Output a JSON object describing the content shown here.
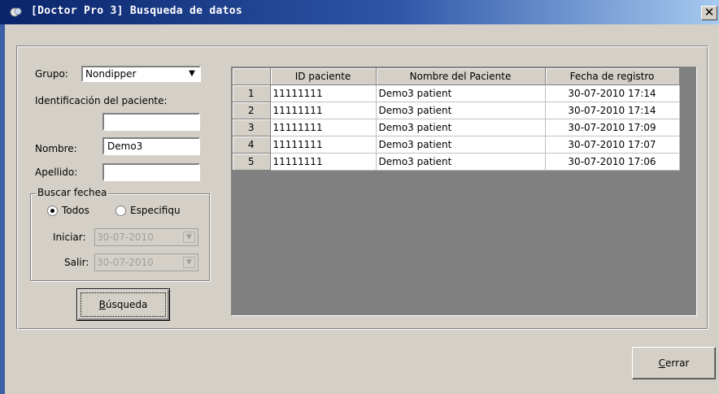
{
  "window": {
    "title": "[Doctor Pro 3] Busqueda de datos",
    "close_symbol": "✕"
  },
  "form": {
    "grupo_label": "Grupo:",
    "grupo_value": "Nondipper",
    "id_label": "Identificación del paciente:",
    "id_value": "",
    "nombre_label": "Nombre:",
    "nombre_value": "Demo3",
    "apellido_label": "Apellido:",
    "apellido_value": "",
    "buscar_fecha": {
      "title": "Buscar fechea",
      "option_all": "Todos",
      "option_specific": "Especifiqu",
      "selected": "Todos",
      "iniciar_label": "Iniciar:",
      "iniciar_value": "30-07-2010",
      "salir_label": "Salir:",
      "salir_value": "30-07-2010"
    },
    "search_button": {
      "mnemonic": "B",
      "rest": "úsqueda"
    }
  },
  "table": {
    "headers": [
      "",
      "ID paciente",
      "Nombre del Paciente",
      "Fecha de registro"
    ],
    "rows": [
      {
        "n": "1",
        "id": "11111111",
        "name": "Demo3 patient",
        "date": "30-07-2010 17:14"
      },
      {
        "n": "2",
        "id": "11111111",
        "name": "Demo3 patient",
        "date": "30-07-2010 17:14"
      },
      {
        "n": "3",
        "id": "11111111",
        "name": "Demo3 patient",
        "date": "30-07-2010 17:09"
      },
      {
        "n": "4",
        "id": "11111111",
        "name": "Demo3 patient",
        "date": "30-07-2010 17:07"
      },
      {
        "n": "5",
        "id": "11111111",
        "name": "Demo3 patient",
        "date": "30-07-2010 17:06"
      }
    ]
  },
  "footer": {
    "close_button": {
      "mnemonic": "C",
      "rest": "errar"
    }
  },
  "colors": {
    "titlebar_start": "#0a246a",
    "titlebar_end": "#a6caf0",
    "face": "#d4d0c8"
  },
  "icons": {
    "app": "doctor-pro-app-icon",
    "close": "close-icon",
    "dropdown": "chevron-down-icon"
  }
}
